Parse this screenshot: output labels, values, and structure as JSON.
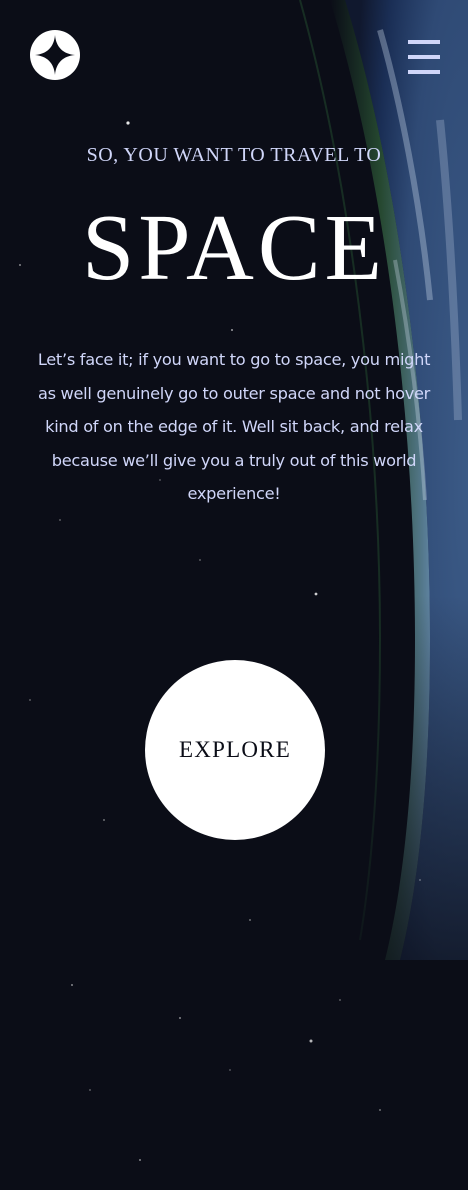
{
  "header": {
    "logo_icon": "four-point-star-icon",
    "menu_icon": "hamburger-menu-icon"
  },
  "hero": {
    "kicker": "SO, YOU WANT TO TRAVEL TO",
    "title": "SPACE",
    "description": "Let’s face it; if you want to go to space, you might as well genuinely go to outer space and not hover kind of on the edge of it. Well sit back, and relax because we’ll give you a truly out of this world experience!"
  },
  "cta": {
    "explore_label": "EXPLORE"
  },
  "colors": {
    "background": "#0b0d17",
    "text_light": "#d0d6f9",
    "white": "#ffffff"
  }
}
